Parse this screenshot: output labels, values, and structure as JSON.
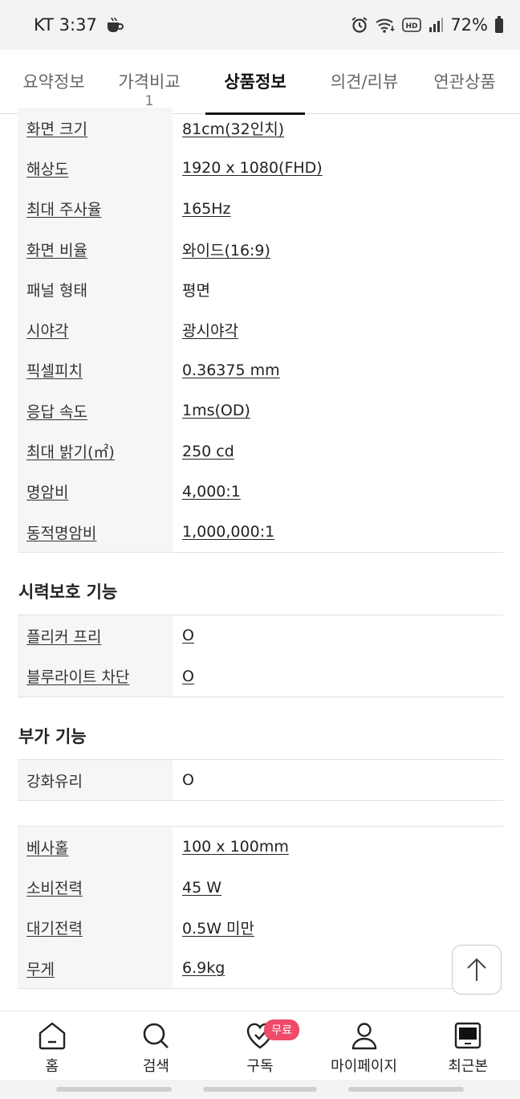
{
  "status_bar": {
    "carrier_time": "KT 3:37",
    "battery": "72%"
  },
  "tabs": [
    {
      "label": "요약정보",
      "count": ""
    },
    {
      "label": "가격비교",
      "count": "1"
    },
    {
      "label": "상품정보",
      "count": ""
    },
    {
      "label": "의견/리뷰",
      "count": ""
    },
    {
      "label": "연관상품",
      "count": ""
    }
  ],
  "specs_display": [
    {
      "key": "화면 크기",
      "value": "81cm(32인치)"
    },
    {
      "key": "해상도",
      "value": "1920 x 1080(FHD)"
    },
    {
      "key": "최대 주사율",
      "value": "165Hz"
    },
    {
      "key": "화면 비율",
      "value": "와이드(16:9)"
    },
    {
      "key": "패널 형태",
      "value": "평면"
    },
    {
      "key": "시야각",
      "value": "광시야각"
    },
    {
      "key": "픽셀피치",
      "value": "0.36375 mm"
    },
    {
      "key": "응답 속도",
      "value": "1ms(OD)"
    },
    {
      "key": "최대 밝기(㎡)",
      "value": "250 cd"
    },
    {
      "key": "명암비",
      "value": "4,000:1"
    },
    {
      "key": "동적명암비",
      "value": "1,000,000:1"
    }
  ],
  "eye_care": {
    "title": "시력보호 기능",
    "rows": [
      {
        "key": "플리커 프리",
        "value": "O"
      },
      {
        "key": "블루라이트 차단",
        "value": "O"
      }
    ]
  },
  "extra": {
    "title": "부가 기능",
    "rows": [
      {
        "key": "강화유리",
        "value": "O"
      }
    ]
  },
  "misc": [
    {
      "key": "베사홀",
      "value": "100 x 100mm"
    },
    {
      "key": "소비전력",
      "value": "45 W"
    },
    {
      "key": "대기전력",
      "value": "0.5W 미만"
    },
    {
      "key": "무게",
      "value": "6.9kg"
    }
  ],
  "bottom_nav": [
    {
      "label": "홈"
    },
    {
      "label": "검색"
    },
    {
      "label": "구독",
      "badge": "무료"
    },
    {
      "label": "마이페이지"
    },
    {
      "label": "최근본"
    }
  ]
}
